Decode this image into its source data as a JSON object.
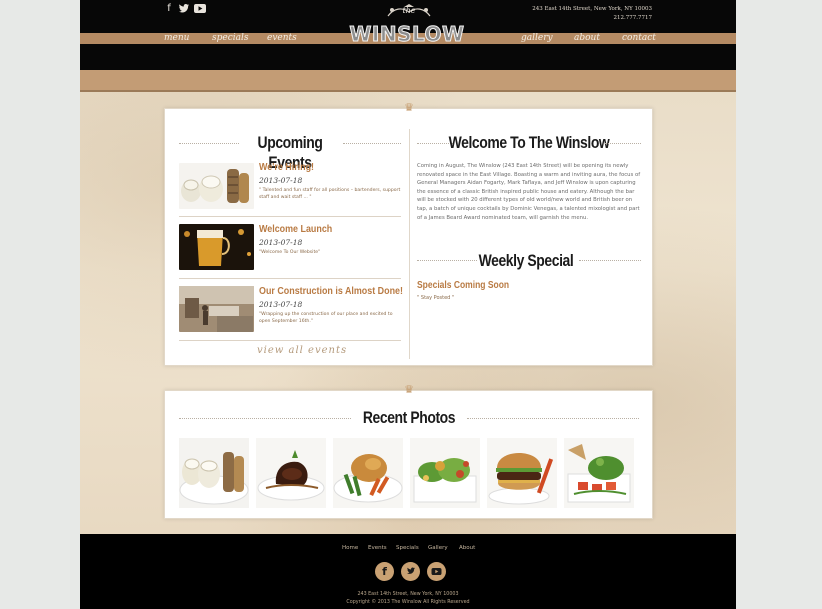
{
  "header": {
    "logo_the": "the",
    "logo_name": "WINSLOW",
    "address": "243 East 14th Street, New York, NY 10003",
    "phone": "212.777.7717",
    "social_icons": [
      "facebook-icon",
      "twitter-icon",
      "youtube-icon"
    ],
    "nav_left": [
      "menu",
      "specials",
      "events"
    ],
    "nav_right": [
      "gallery",
      "about",
      "contact"
    ]
  },
  "events": {
    "title": "Upcoming Events",
    "items": [
      {
        "title": "We're Hiring!",
        "date": "2013-07-18",
        "desc": "\" Talented and fun staff for all positions – bartenders, support staff and wait staff ... \""
      },
      {
        "title": "Welcome Launch",
        "date": "2013-07-18",
        "desc": "\"Welcome To Our Website\""
      },
      {
        "title": "Our Construction is Almost Done!",
        "date": "2013-07-18",
        "desc": "\"Wrapping up the construction of our place and excited to open September 16th.\""
      }
    ],
    "view_all": "view all events"
  },
  "welcome": {
    "title": "Welcome To The Winslow",
    "body": "Coming in August, The Winslow (243 East 14th Street) will be opening its newly renovated space in the East Village. Boasting a warm and inviting aura, the focus of General Managers Aidan Fogarty, Mark Taflaya, and Jeff Winslow is upon capturing the essence of a classic British inspired public house and eatery. Although the bar will be stocked with 20 different types of old world/new world and British beer on tap, a batch of unique cocktails by Dominic Venegas, a talented mixologist and part of a James Beard Award nominated team, will garnish the menu."
  },
  "special": {
    "title": "Weekly Special",
    "item_title": "Specials Coming Soon",
    "item_desc": "\" Stay Posted \""
  },
  "photos": {
    "title": "Recent Photos",
    "items": [
      "sushi-photo",
      "steak-photo",
      "roast-chicken-photo",
      "salad-photo",
      "burger-photo",
      "tuna-salad-photo"
    ]
  },
  "footer": {
    "links": [
      "Home",
      "Events",
      "Specials",
      "Gallery",
      "About"
    ],
    "address": "243 East 14th Street, New York, NY 10003",
    "copyright": "Copyright © 2013 The Winslow All Rights Reserved",
    "social_icons": [
      "facebook-icon",
      "twitter-icon",
      "youtube-icon"
    ]
  },
  "colors": {
    "accent": "#b97b44",
    "nav_strip": "#b48a63",
    "header_bg": "#070707"
  }
}
